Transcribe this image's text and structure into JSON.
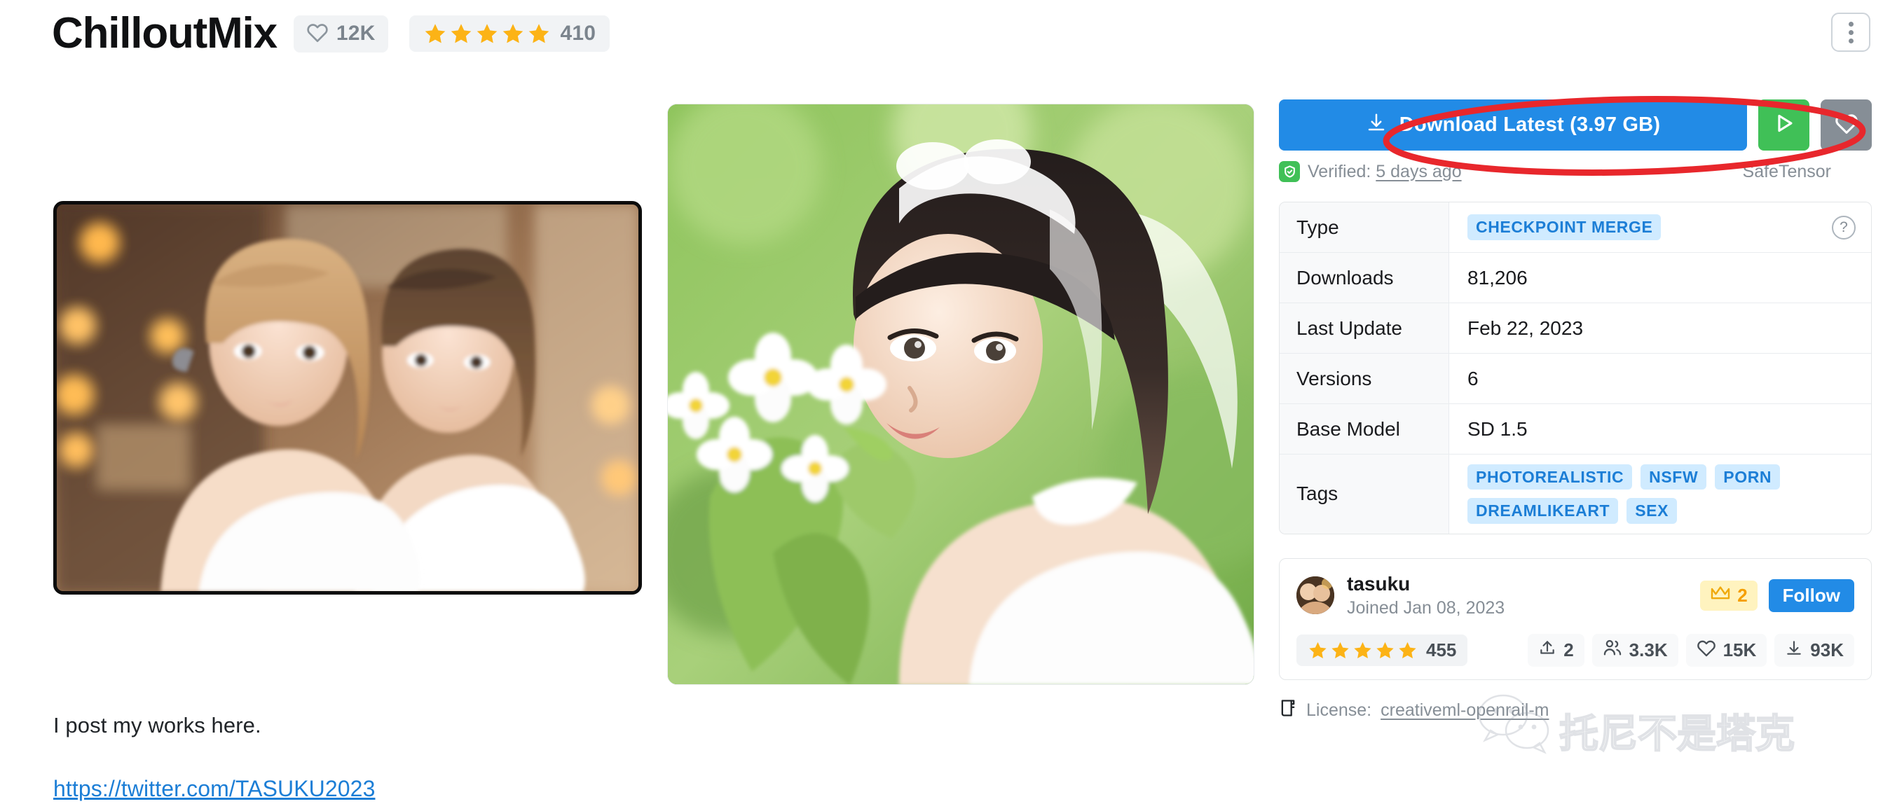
{
  "header": {
    "title": "ChilloutMix",
    "likes_icon": "heart-icon",
    "likes_count": "12K",
    "rating_stars": 5,
    "rating_count": "410",
    "menu_icon": "three-dot-menu-icon"
  },
  "gallery": {
    "left_image_alt": "two women portrait preview",
    "center_image_alt": "bride with white flowers preview"
  },
  "description": {
    "text": "I post my works here.",
    "link": "https://twitter.com/TASUKU2023"
  },
  "actions": {
    "download_label": "Download Latest (3.97 GB)",
    "download_icon": "download-icon",
    "run_icon": "play-icon",
    "favorite_icon": "heart-icon",
    "verified_prefix": "Verified:",
    "verified_time": "5 days ago",
    "verified_icon": "shield-check-icon",
    "format_label": "SafeTensor",
    "accent_color": "#228be6",
    "run_color": "#40c057",
    "favorite_color": "#868e96"
  },
  "info_table": {
    "rows": [
      {
        "key": "Type",
        "value": "",
        "badges": [
          "CHECKPOINT MERGE"
        ],
        "help_icon": "question-circle-icon"
      },
      {
        "key": "Downloads",
        "value": "81,206",
        "badges": []
      },
      {
        "key": "Last Update",
        "value": "Feb 22, 2023",
        "badges": []
      },
      {
        "key": "Versions",
        "value": "6",
        "badges": []
      },
      {
        "key": "Base Model",
        "value": "SD 1.5",
        "badges": []
      },
      {
        "key": "Tags",
        "value": "",
        "badges": [
          "PHOTOREALISTIC",
          "NSFW",
          "PORN",
          "DREAMLIKEART",
          "SEX"
        ]
      }
    ]
  },
  "creator": {
    "avatar_icon": "user-avatar",
    "name": "tasuku",
    "joined": "Joined Jan 08, 2023",
    "crown_icon": "crown-icon",
    "crown_count": "2",
    "follow_label": "Follow",
    "rating_stars": 5,
    "rating_count": "455",
    "stats": [
      {
        "icon": "upload-icon",
        "value": "2"
      },
      {
        "icon": "users-icon",
        "value": "3.3K"
      },
      {
        "icon": "heart-icon",
        "value": "15K"
      },
      {
        "icon": "download-icon",
        "value": "93K"
      }
    ]
  },
  "license": {
    "icon": "license-scroll-icon",
    "prefix": "License:",
    "name": "creativeml-openrail-m"
  },
  "annotation": {
    "shape": "red-ellipse-highlight",
    "color": "#e8272c",
    "target": "download_button"
  },
  "watermark": {
    "text": "托尼不是塔克",
    "icon": "wechat-logo"
  }
}
